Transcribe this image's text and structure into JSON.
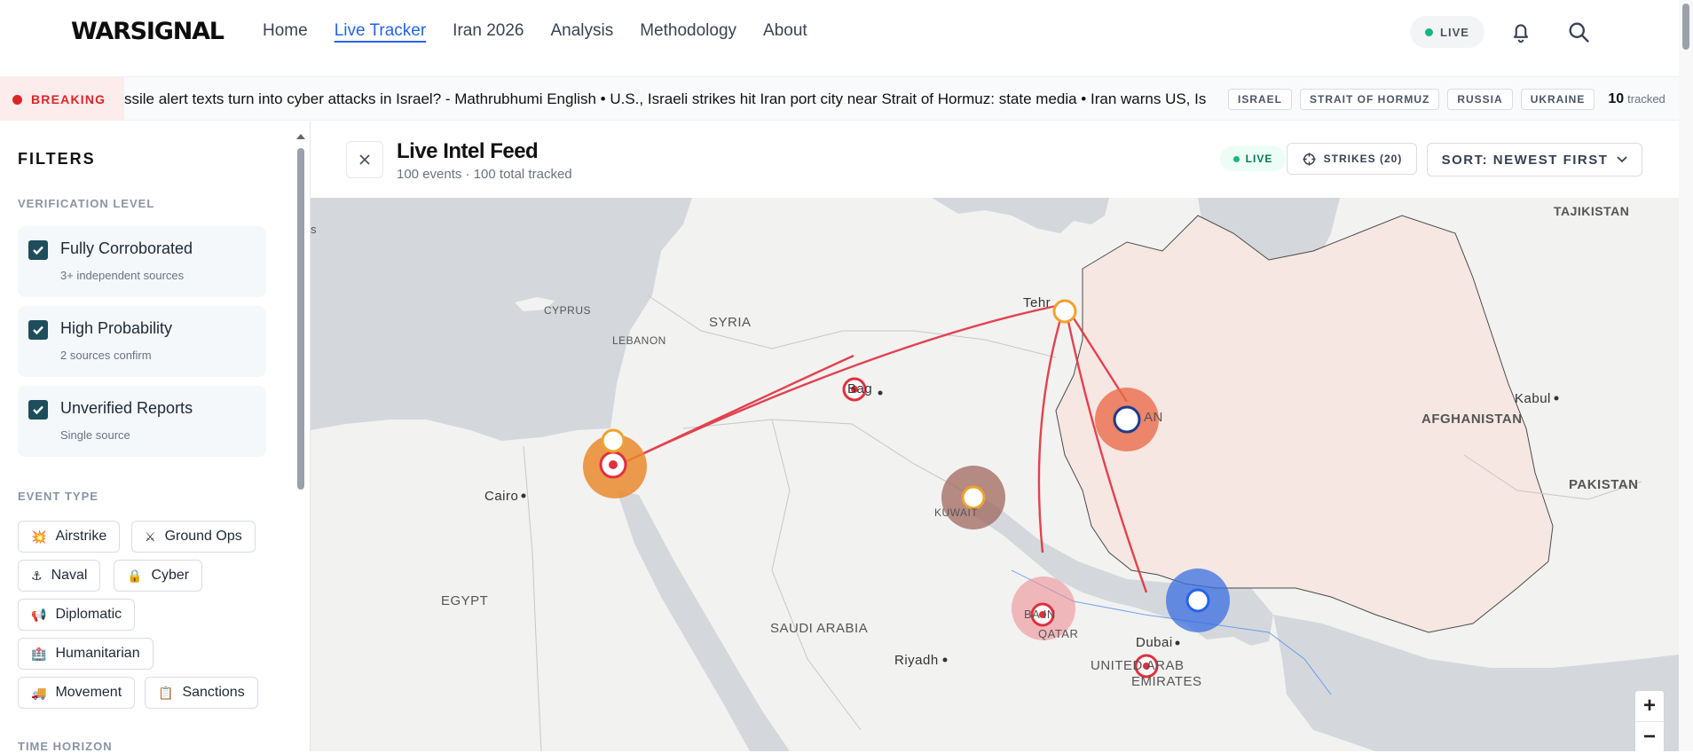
{
  "nav": {
    "logo": "WARSIGNAL",
    "links": [
      "Home",
      "Live Tracker",
      "Iran 2026",
      "Analysis",
      "Methodology",
      "About"
    ],
    "live_label": "LIVE"
  },
  "ticker": {
    "breaking_label": "BREAKING",
    "text": "ssile alert texts turn into cyber attacks in Israel? - Mathrubhumi English • U.S., Israeli strikes hit Iran port city near Strait of Hormuz: state media • Iran warns US, Israel t",
    "tags": [
      "ISRAEL",
      "STRAIT OF HORMUZ",
      "RUSSIA",
      "UKRAINE"
    ],
    "tracked_count": "10",
    "tracked_label": "tracked"
  },
  "sidebar": {
    "title": "FILTERS",
    "verification_label": "VERIFICATION LEVEL",
    "verification": [
      {
        "title": "Fully Corroborated",
        "sub": "3+ independent sources"
      },
      {
        "title": "High Probability",
        "sub": "2 sources confirm"
      },
      {
        "title": "Unverified Reports",
        "sub": "Single source"
      }
    ],
    "event_type_label": "EVENT TYPE",
    "event_types": [
      {
        "label": "Airstrike",
        "icon": "💥"
      },
      {
        "label": "Ground Ops",
        "icon": "⚔"
      },
      {
        "label": "Naval",
        "icon": "⚓"
      },
      {
        "label": "Cyber",
        "icon": "🔒"
      },
      {
        "label": "Diplomatic",
        "icon": "📢"
      },
      {
        "label": "Humanitarian",
        "icon": "🏥"
      },
      {
        "label": "Movement",
        "icon": "🚚"
      },
      {
        "label": "Sanctions",
        "icon": "📋"
      }
    ],
    "time_horizon_label": "TIME HORIZON"
  },
  "feed": {
    "title": "Live Intel Feed",
    "subtitle": "100 events · 100 total tracked",
    "live_label": "LIVE",
    "strikes_label": "STRIKES (20)",
    "sort_label": "SORT: NEWEST FIRST"
  },
  "map": {
    "labels": {
      "tajikistan": "TAJIKISTAN",
      "cyprus": "CYPRUS",
      "syria": "SYRIA",
      "lebanon": "LEBANON",
      "tehran": "Tehr",
      "baghdad": "Bag",
      "iran": "AN",
      "kabul": "Kabul",
      "afghanistan": "AFGHANISTAN",
      "cairo": "Cairo",
      "kuwait": "KUWAIT",
      "pakistan": "PAKISTAN",
      "egypt": "EGYPT",
      "saudi": "SAUDI ARABIA",
      "bahrain": "BA   IN",
      "qatar": "QATAR",
      "dubai": "Dubai",
      "riyadh": "Riyadh",
      "uae1": "UNITED ARAB",
      "uae2": "EMIRATES",
      "s_edge": "s"
    },
    "zoom_in": "+",
    "zoom_out": "−"
  },
  "colors": {
    "accent": "#2563eb",
    "strike_line": "#e0303e",
    "live_green": "#10b981",
    "breaking_red": "#dc2626",
    "checkbox": "#1e4e5c"
  }
}
